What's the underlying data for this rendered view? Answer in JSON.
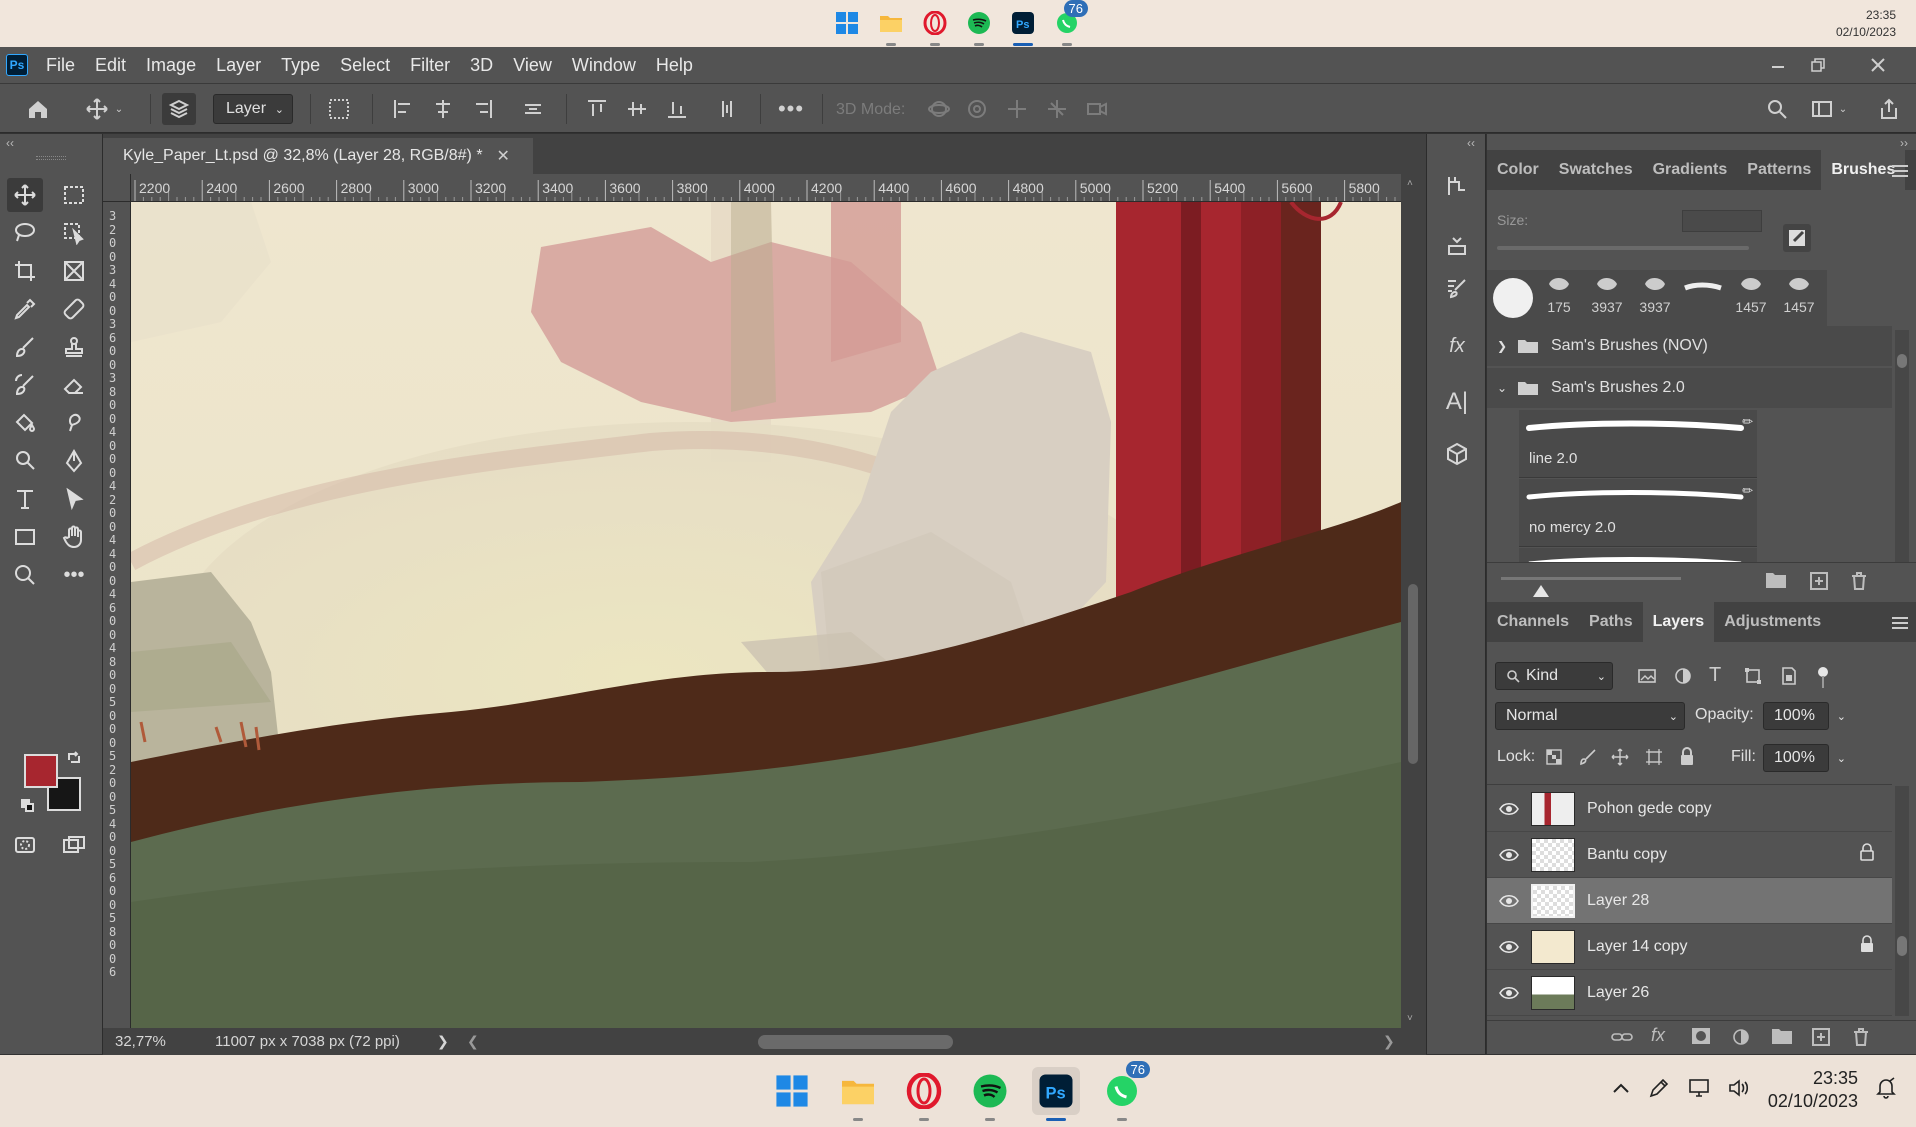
{
  "top_taskbar": {
    "time": "23:35",
    "date": "02/10/2023",
    "whatsapp_badge": "76"
  },
  "menubar": {
    "items": [
      "File",
      "Edit",
      "Image",
      "Layer",
      "Type",
      "Select",
      "Filter",
      "3D",
      "View",
      "Window",
      "Help"
    ]
  },
  "options_bar": {
    "auto_select_target": "Layer",
    "mode_3d_label": "3D Mode:"
  },
  "document": {
    "tab_title": "Kyle_Paper_Lt.psd @ 32,8% (Layer 28, RGB/8#) *",
    "zoom": "32,77%",
    "dimensions": "11007 px x 7038 px (72 ppi)"
  },
  "rulers": {
    "top_labels": [
      "2200",
      "2400",
      "2600",
      "2800",
      "3000",
      "3200",
      "3400",
      "3600",
      "3800",
      "4000",
      "4200",
      "4400",
      "4600",
      "4800",
      "5000",
      "5200",
      "5400",
      "5600",
      "5800"
    ],
    "left_labels": [
      "3",
      "2",
      "0",
      "0",
      "3",
      "4",
      "0",
      "0",
      "3",
      "6",
      "0",
      "0",
      "3",
      "8",
      "0",
      "0",
      "4",
      "0",
      "0",
      "0",
      "4",
      "2",
      "0",
      "0",
      "4",
      "4",
      "0",
      "0",
      "4",
      "6",
      "0",
      "0",
      "4",
      "8",
      "0",
      "0",
      "5",
      "0",
      "0",
      "0",
      "5",
      "2",
      "0",
      "0",
      "5",
      "4",
      "0",
      "0",
      "5",
      "6",
      "0",
      "0",
      "5",
      "8",
      "0",
      "0",
      "6"
    ]
  },
  "brushes_panel": {
    "tabs": [
      "Color",
      "Swatches",
      "Gradients",
      "Patterns",
      "Brushes"
    ],
    "active_tab": "Brushes",
    "size_label": "Size:",
    "recent_brushes": [
      "175",
      "3937",
      "3937",
      "",
      "1457",
      "1457"
    ],
    "folders": [
      "Sam's Brushes (NOV)",
      "Sam's Brushes 2.0"
    ],
    "brush_items": [
      "line 2.0",
      "no mercy 2.0"
    ]
  },
  "layers_panel": {
    "tabs": [
      "Channels",
      "Paths",
      "Layers",
      "Adjustments"
    ],
    "active_tab": "Layers",
    "filter_kind": "Kind",
    "blend_mode": "Normal",
    "opacity_label": "Opacity:",
    "opacity": "100%",
    "lock_label": "Lock:",
    "fill_label": "Fill:",
    "fill": "100%",
    "layers": [
      {
        "name": "Pohon gede copy",
        "locked": false,
        "selected": false
      },
      {
        "name": "Bantu copy",
        "locked": true,
        "selected": false
      },
      {
        "name": "Layer 28",
        "locked": false,
        "selected": true
      },
      {
        "name": "Layer 14 copy",
        "locked": true,
        "selected": false
      },
      {
        "name": "Layer 26",
        "locked": false,
        "selected": false
      }
    ]
  },
  "taskbar": {
    "time": "23:35",
    "date": "02/10/2023",
    "whatsapp_badge": "76"
  },
  "colors": {
    "foreground": "#a7262f",
    "background": "#161616",
    "ui_panel": "#535353",
    "ui_dark": "#424242"
  }
}
